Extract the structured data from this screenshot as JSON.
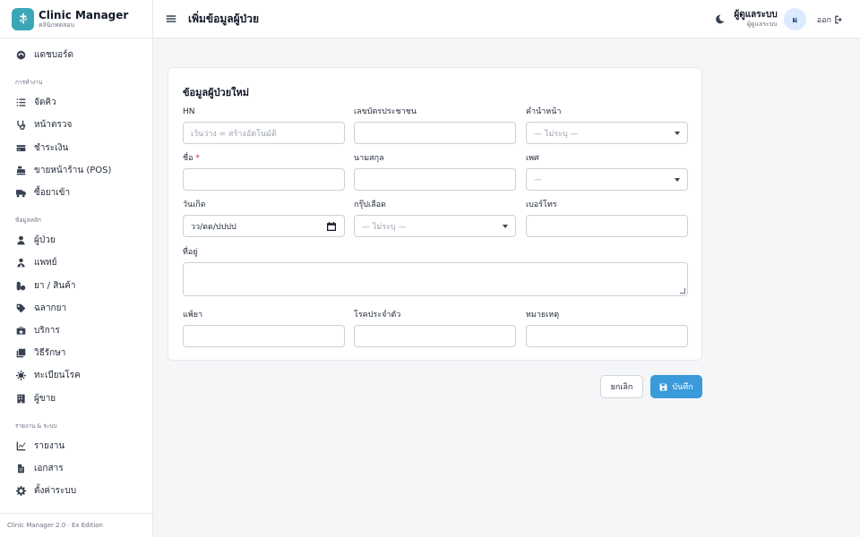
{
  "app": {
    "name": "Clinic Manager",
    "subtitle": "คลินิกทดสอบ",
    "footer": "Clinic Manager 2.0 · Ex Edition"
  },
  "sidebar": {
    "dashboard": {
      "label": "แดชบอร์ด",
      "icon": "dashboard-icon"
    },
    "section_operations": "การทำงาน",
    "operations": [
      {
        "label": "จัดคิว",
        "icon": "list-icon"
      },
      {
        "label": "หน้าตรวจ",
        "icon": "stethoscope-icon"
      },
      {
        "label": "ชำระเงิน",
        "icon": "credit-card-icon"
      },
      {
        "label": "ขายหน้าร้าน (POS)",
        "icon": "cash-register-icon"
      },
      {
        "label": "ซื้อยาเข้า",
        "icon": "truck-icon"
      }
    ],
    "section_master": "ข้อมูลหลัก",
    "master": [
      {
        "label": "ผู้ป่วย",
        "icon": "user-icon"
      },
      {
        "label": "แพทย์",
        "icon": "doctor-icon"
      },
      {
        "label": "ยา / สินค้า",
        "icon": "pills-icon"
      },
      {
        "label": "ฉลากยา",
        "icon": "tag-icon"
      },
      {
        "label": "บริการ",
        "icon": "medical-kit-icon"
      },
      {
        "label": "วิธีรักษา",
        "icon": "layers-icon"
      },
      {
        "label": "ทะเบียนโรค",
        "icon": "virus-icon"
      },
      {
        "label": "ผู้ขาย",
        "icon": "building-icon"
      }
    ],
    "section_reports": "รายงาน & ระบบ",
    "reports": [
      {
        "label": "รายงาน",
        "icon": "chart-icon"
      },
      {
        "label": "เอกสาร",
        "icon": "document-icon"
      },
      {
        "label": "ตั้งค่าระบบ",
        "icon": "gear-icon"
      }
    ]
  },
  "header": {
    "title": "เพิ่มข้อมูลผู้ป่วย",
    "user_name": "ผู้ดูแลระบบ",
    "user_role": "ผู้ดูแลระบบ",
    "avatar_initial": "ผ",
    "logout_label": "ออก"
  },
  "form": {
    "title": "ข้อมูลผู้ป่วยใหม่",
    "hn": {
      "label": "HN",
      "placeholder": "เว้นว่าง = สร้างอัตโนมัติ"
    },
    "national_id": {
      "label": "เลขบัตรประชาชน",
      "value": ""
    },
    "prefix": {
      "label": "คำนำหน้า",
      "selected": "— ไม่ระบุ —"
    },
    "first_name": {
      "label": "ชื่อ",
      "required_mark": "*",
      "value": ""
    },
    "last_name": {
      "label": "นามสกุล",
      "value": ""
    },
    "gender": {
      "label": "เพศ",
      "selected": "—"
    },
    "birth_date": {
      "label": "วันเกิด",
      "value": "วว/ดด/ปปปป"
    },
    "blood_group": {
      "label": "กรุ๊ปเลือด",
      "selected": "— ไม่ระบุ —"
    },
    "phone": {
      "label": "เบอร์โทร",
      "value": ""
    },
    "address": {
      "label": "ที่อยู่",
      "value": ""
    },
    "allergy": {
      "label": "แพ้ยา",
      "value": ""
    },
    "chronic": {
      "label": "โรคประจำตัว",
      "value": ""
    },
    "note": {
      "label": "หมายเหตุ",
      "value": ""
    }
  },
  "actions": {
    "cancel_label": "ยกเลิก",
    "save_label": "บันทึก"
  },
  "colors": {
    "brand": "#3aa7b8",
    "primary": "#3b9ad9",
    "required": "#dc2626"
  }
}
